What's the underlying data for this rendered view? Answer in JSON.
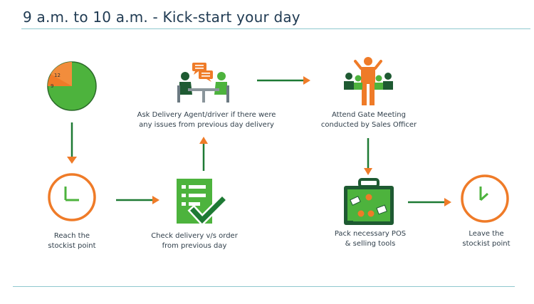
{
  "title": "9 a.m. to 10 a.m. - Kick-start your day",
  "pie_clock": {
    "label_12": "12",
    "label_9": "9"
  },
  "steps": {
    "reach": {
      "line1": "Reach the",
      "line2": "stockist point"
    },
    "check": {
      "line1": "Check delivery v/s order",
      "line2": "from previous day"
    },
    "ask": {
      "line1": "Ask Delivery Agent/driver if there were",
      "line2": "any issues from previous day delivery"
    },
    "meeting": {
      "line1": "Attend Gate Meeting",
      "line2": "conducted by Sales Officer"
    },
    "pack": {
      "line1": "Pack necessary POS",
      "line2": "& selling tools"
    },
    "leave": {
      "line1": "Leave the",
      "line2": "stockist point"
    }
  },
  "colors": {
    "green": "#4db33d",
    "dark_green": "#1e7a34",
    "orange": "#ef7b28",
    "title": "#1f3a52"
  }
}
